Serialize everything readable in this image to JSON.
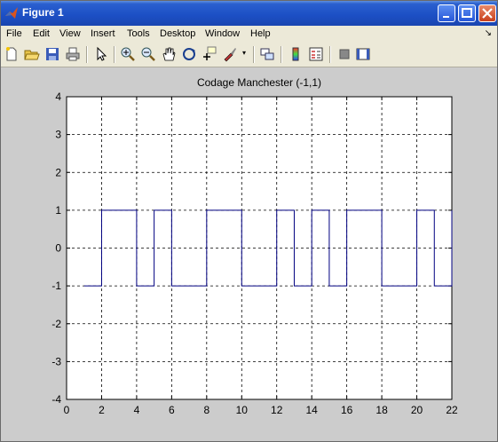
{
  "window": {
    "title": "Figure 1"
  },
  "menu": [
    "File",
    "Edit",
    "View",
    "Insert",
    "Tools",
    "Desktop",
    "Window",
    "Help"
  ],
  "toolbar": {
    "tools": [
      "new-figure-icon",
      "open-file-icon",
      "save-icon",
      "print-icon",
      "pointer-icon",
      "zoom-in-icon",
      "zoom-out-icon",
      "pan-icon",
      "rotate-3d-icon",
      "data-cursor-icon",
      "brush-icon",
      "link-plot-icon",
      "colorbar-icon",
      "legend-icon",
      "hide-plot-tools-icon",
      "show-plot-tools-icon"
    ]
  },
  "chart_data": {
    "type": "line",
    "title": "Codage Manchester (-1,1)",
    "xlabel": "",
    "ylabel": "",
    "xlim": [
      0,
      22
    ],
    "ylim": [
      -4,
      4
    ],
    "x_ticks": [
      0,
      2,
      4,
      6,
      8,
      10,
      12,
      14,
      16,
      18,
      20,
      22
    ],
    "y_ticks": [
      -4,
      -3,
      -2,
      -1,
      0,
      1,
      2,
      3,
      4
    ],
    "grid": true,
    "line_color": "#000080",
    "series": [
      {
        "x": [
          1,
          2,
          2,
          4,
          4,
          5,
          5,
          6,
          6,
          8,
          8,
          10,
          10,
          12,
          12,
          13,
          13,
          14,
          14,
          15,
          15,
          16,
          16,
          18,
          18,
          20,
          20,
          21,
          21,
          22,
          22
        ],
        "y": [
          -1,
          -1,
          1,
          1,
          -1,
          -1,
          1,
          1,
          -1,
          -1,
          1,
          1,
          -1,
          -1,
          1,
          1,
          -1,
          -1,
          1,
          1,
          -1,
          -1,
          1,
          1,
          -1,
          -1,
          1,
          1,
          -1,
          -1,
          1
        ]
      }
    ]
  }
}
